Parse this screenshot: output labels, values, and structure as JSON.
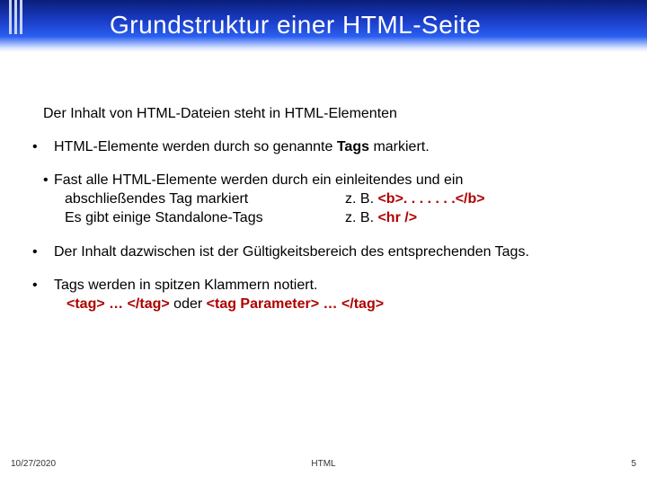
{
  "header": {
    "title": "Grundstruktur einer HTML-Seite"
  },
  "content": {
    "intro": "Der Inhalt von HTML-Dateien steht in HTML-Elementen",
    "bullet1": {
      "t1": "HTML-Elemente werden durch so genannte ",
      "tags": "Tags",
      "t2": " markiert."
    },
    "bullet2": {
      "r1c1": "Fast alle HTML-Elemente werden durch ein einleitendes und ein",
      "r2c1": "abschließendes Tag markiert",
      "r2c2a": "z. B. ",
      "r2c2b": "<b>. . . . . . .</b>",
      "r3c1": "Es gibt einige Standalone-Tags",
      "r3c2a": "z. B. ",
      "r3c2b": "<hr />"
    },
    "bullet3": "Der Inhalt dazwischen ist der Gültigkeitsbereich des entsprechenden Tags.",
    "bullet4": {
      "line1": "Tags werden in spitzen Klammern notiert.",
      "ex1": "<tag> … </tag>",
      "oder": "   oder   ",
      "ex2": "<tag Parameter> … </tag>"
    }
  },
  "footer": {
    "date": "10/27/2020",
    "topic": "HTML",
    "page": "5"
  }
}
